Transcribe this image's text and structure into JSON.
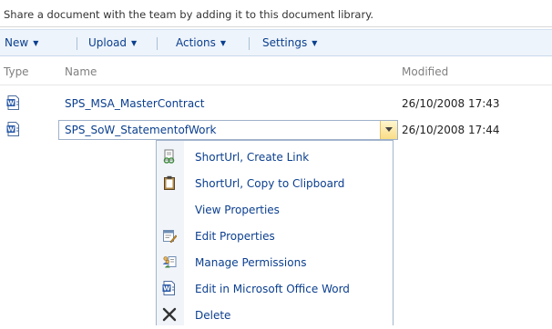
{
  "description": "Share a document with the team by adding it to this document library.",
  "toolbar": {
    "items": [
      {
        "label": "New",
        "has_dropdown": true
      },
      {
        "label": "Upload",
        "has_dropdown": true
      },
      {
        "label": "Actions",
        "has_dropdown": true
      },
      {
        "label": "Settings",
        "has_dropdown": true
      }
    ]
  },
  "columns": {
    "type": "Type",
    "name": "Name",
    "modified": "Modified"
  },
  "documents": [
    {
      "icon": "word-document-icon",
      "name": "SPS_MSA_MasterContract",
      "modified": "26/10/2008 17:43"
    },
    {
      "icon": "word-document-icon",
      "name": "SPS_SoW_StatementofWork",
      "modified": "26/10/2008 17:44",
      "selected": true
    }
  ],
  "context_menu": {
    "items": [
      {
        "label": "ShortUrl, Create Link",
        "icon": "shorturl-link-icon"
      },
      {
        "label": "ShortUrl, Copy to Clipboard",
        "icon": "clipboard-icon"
      },
      {
        "label": "View Properties",
        "icon": ""
      },
      {
        "label": "Edit Properties",
        "icon": "edit-properties-icon"
      },
      {
        "label": "Manage Permissions",
        "icon": "permissions-icon"
      },
      {
        "label": "Edit in Microsoft Office Word",
        "icon": "word-document-icon"
      },
      {
        "label": "Delete",
        "icon": "delete-x-icon"
      }
    ]
  },
  "colors": {
    "link": "#0b3f8f",
    "toolbar_bg": "#eef4fb",
    "menu_border": "#a3b5cd",
    "dropdown_button": "#f9dd86"
  }
}
